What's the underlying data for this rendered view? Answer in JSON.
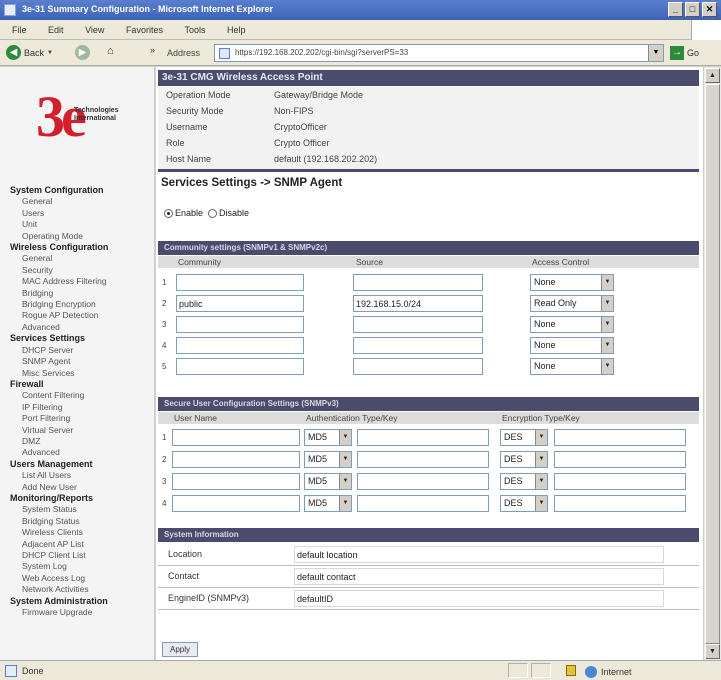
{
  "window": {
    "title": "3e-31 Summary Configuration - Microsoft Internet Explorer",
    "min": "_",
    "max": "□",
    "close": "✕"
  },
  "menu": [
    "File",
    "Edit",
    "View",
    "Favorites",
    "Tools",
    "Help"
  ],
  "toolbar": {
    "back_label": "Back",
    "address_label": "Address",
    "url": "https://192.168.202.202/cgi-bin/sgi?serverPS=33",
    "go_label": "Go"
  },
  "sidebar": {
    "logo_text": "3e",
    "logo_tagline": "Technologies International",
    "groups": [
      {
        "label": "System Configuration",
        "items": [
          "General",
          "Users",
          "Unit",
          "Operating Mode"
        ]
      },
      {
        "label": "Wireless Configuration",
        "items": [
          "General",
          "Security",
          "MAC Address Filtering",
          "Bridging",
          "Bridging Encryption",
          "Rogue AP Detection",
          "Advanced"
        ]
      },
      {
        "label": "Services Settings",
        "items": [
          "DHCP Server",
          "SNMP Agent",
          "Misc Services"
        ]
      },
      {
        "label": "Firewall",
        "items": [
          "Content Filtering",
          "IP Filtering",
          "Port Filtering",
          "Virtual Server",
          "DMZ",
          "Advanced"
        ]
      },
      {
        "label": "Users Management",
        "items": [
          "List All Users",
          "Add New User"
        ]
      },
      {
        "label": "Monitoring/Reports",
        "items": [
          "System Status",
          "Bridging Status",
          "Wireless Clients",
          "Adjacent AP List",
          "DHCP Client List",
          "System Log",
          "Web Access Log",
          "Network Activities"
        ]
      },
      {
        "label": "System Administration",
        "items": [
          "Firmware Upgrade"
        ]
      }
    ]
  },
  "device": {
    "header": "3e-31 CMG Wireless Access Point",
    "info": [
      {
        "label": "Operation Mode",
        "value": "Gateway/Bridge Mode"
      },
      {
        "label": "Security Mode",
        "value": "Non-FIPS"
      },
      {
        "label": "Username",
        "value": "CryptoOfficer"
      },
      {
        "label": "Role",
        "value": "Crypto Officer"
      },
      {
        "label": "Host Name",
        "value": "default (192.168.202.202)"
      }
    ]
  },
  "page": {
    "title": "Services Settings -> SNMP Agent",
    "enable_label": "Enable",
    "disable_label": "Disable",
    "enabled": true
  },
  "community": {
    "header": "Community settings (SNMPv1 & SNMPv2c)",
    "col_community": "Community",
    "col_source": "Source",
    "col_access": "Access Control",
    "rows": [
      {
        "num": "1",
        "community": "",
        "source": "",
        "access": "None"
      },
      {
        "num": "2",
        "community": "public",
        "source": "192.168.15.0/24",
        "access": "Read Only"
      },
      {
        "num": "3",
        "community": "",
        "source": "",
        "access": "None"
      },
      {
        "num": "4",
        "community": "",
        "source": "",
        "access": "None"
      },
      {
        "num": "5",
        "community": "",
        "source": "",
        "access": "None"
      }
    ]
  },
  "secure_users": {
    "header": "Secure User Configuration Settings (SNMPv3)",
    "col_user": "User Name",
    "col_auth": "Authentication Type/Key",
    "col_enc": "Encryption Type/Key",
    "rows": [
      {
        "num": "1",
        "user": "",
        "auth_type": "MD5",
        "auth_key": "",
        "enc_type": "DES",
        "enc_key": ""
      },
      {
        "num": "2",
        "user": "",
        "auth_type": "MD5",
        "auth_key": "",
        "enc_type": "DES",
        "enc_key": ""
      },
      {
        "num": "3",
        "user": "",
        "auth_type": "MD5",
        "auth_key": "",
        "enc_type": "DES",
        "enc_key": ""
      },
      {
        "num": "4",
        "user": "",
        "auth_type": "MD5",
        "auth_key": "",
        "enc_type": "DES",
        "enc_key": ""
      }
    ]
  },
  "system_info": {
    "header": "System Information",
    "fields": [
      {
        "label": "Location",
        "value": "default location"
      },
      {
        "label": "Contact",
        "value": "default contact"
      },
      {
        "label": "EngineID (SNMPv3)",
        "value": "defaultID"
      }
    ]
  },
  "apply_label": "Apply",
  "status": {
    "text": "Done",
    "zone": "Internet"
  },
  "colors": {
    "section_header": "#4b4b6e",
    "logo_red": "#d21f2b"
  }
}
